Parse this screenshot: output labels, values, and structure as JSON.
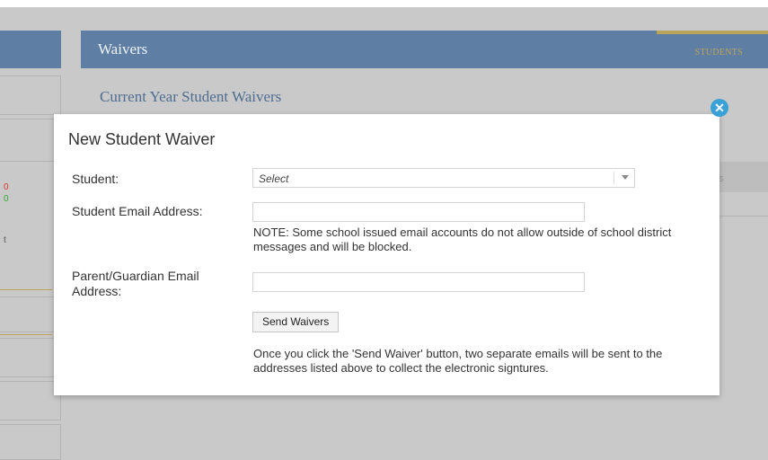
{
  "header": {
    "title": "Waivers",
    "tab_label": "STUDENTS"
  },
  "page": {
    "subtitle": "Current Year Student Waivers"
  },
  "background": {
    "panel_text": "s",
    "left_marks": [
      "0",
      "0",
      "t"
    ]
  },
  "modal": {
    "title": "New Student Waiver",
    "close_icon": "close-icon",
    "student_label": "Student:",
    "student_select_value": "Select",
    "student_email_label": "Student Email Address:",
    "student_email_value": "",
    "note": "NOTE: Some school issued email accounts do not allow outside of school district messages and will be blocked.",
    "parent_email_label": "Parent/Guardian Email Address:",
    "parent_email_value": "",
    "send_button_label": "Send Waivers",
    "footer_text": "Once you click the 'Send Waiver' button, two separate emails will be sent to the addresses listed above to collect the electronic signtures."
  },
  "colors": {
    "header_blue": "#5e7fa3",
    "accent_gold": "#b9a45a",
    "close_blue": "#3aa1d7"
  }
}
